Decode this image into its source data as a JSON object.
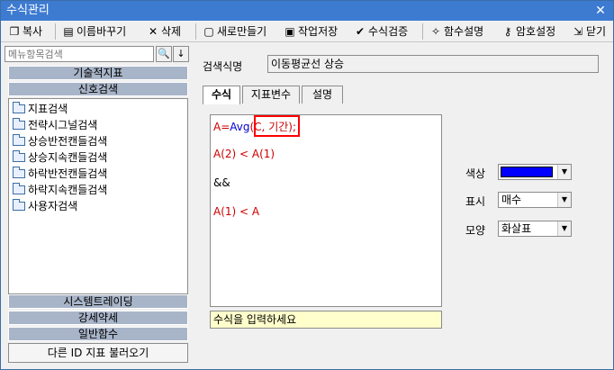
{
  "window": {
    "title": "수식관리",
    "close": "✕"
  },
  "toolbar": {
    "copy": "복사",
    "rename": "이름바꾸기",
    "delete": "삭제",
    "new": "새로만들기",
    "save": "작업저장",
    "verify": "수식검증",
    "func_help": "함수설명",
    "password": "암호설정",
    "close": "닫기"
  },
  "sidebar": {
    "search_placeholder": "메뉴항목검색",
    "search_icon": "🔍",
    "down_icon": "↓",
    "categories_top": [
      "기술적지표",
      "신호검색"
    ],
    "tree_items": [
      "지표검색",
      "전략시그널검색",
      "상승반전캔들검색",
      "상승지속캔들검색",
      "하락반전캔들검색",
      "하락지속캔들검색",
      "사용자검색"
    ],
    "categories_bottom": [
      "시스템트레이딩",
      "강세약세",
      "일반함수"
    ],
    "load_other": "다른 ID 지표 불러오기"
  },
  "main": {
    "name_label": "검색식명",
    "name_value": "이동평균선 상승",
    "tabs": [
      "수식",
      "지표변수",
      "설명"
    ],
    "formula": {
      "line1_a": "A=",
      "line1_b": "Avg",
      "line1_c": "(C, 기간);",
      "line2": "A(2) < A(1)",
      "line3": "&&",
      "line4": "A(1) < A"
    },
    "hint": "수식을 입력하세요"
  },
  "props": {
    "color_label": "색상",
    "color_value": "#0000ff",
    "display_label": "표시",
    "display_value": "매수",
    "shape_label": "모양",
    "shape_value": "화살표"
  }
}
